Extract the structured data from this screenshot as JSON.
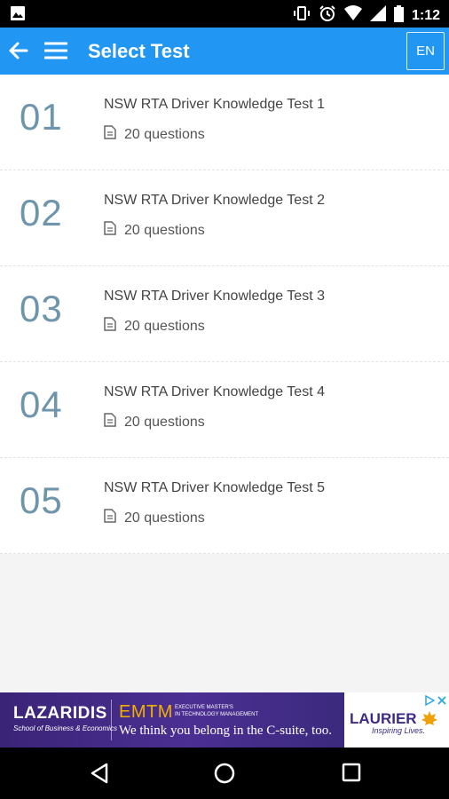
{
  "status_bar": {
    "time": "1:12"
  },
  "app_bar": {
    "title": "Select Test",
    "language": "EN",
    "color": "#2196f3"
  },
  "tests": [
    {
      "number": "01",
      "name": "NSW RTA Driver Knowledge Test 1",
      "questions": "20 questions"
    },
    {
      "number": "02",
      "name": "NSW RTA Driver Knowledge Test 2",
      "questions": "20 questions"
    },
    {
      "number": "03",
      "name": "NSW RTA Driver Knowledge Test 3",
      "questions": "20 questions"
    },
    {
      "number": "04",
      "name": "NSW RTA Driver Knowledge Test 4",
      "questions": "20 questions"
    },
    {
      "number": "05",
      "name": "NSW RTA Driver Knowledge Test 5",
      "questions": "20 questions"
    }
  ],
  "ad": {
    "brand": "LAZARIDIS",
    "brand_sub": "School of Business & Economics",
    "program": "EMTM",
    "program_sub_1": "EXECUTIVE MASTER'S",
    "program_sub_2": "IN TECHNOLOGY MANAGEMENT",
    "tagline": "We think you belong in the C-suite, too.",
    "university": "LAURIER",
    "university_tagline": "Inspiring Lives."
  }
}
